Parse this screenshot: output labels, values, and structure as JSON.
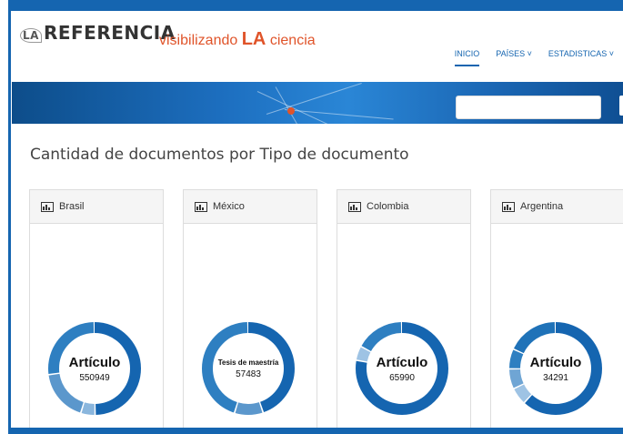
{
  "header": {
    "logo_prefix": "LA",
    "logo_text": "REFERENCIA",
    "tagline_pre": "visibilizando ",
    "tagline_bold": "LA",
    "tagline_post": " ciencia"
  },
  "nav": {
    "items": [
      {
        "label": "INICIO"
      },
      {
        "label": "PAÍSES ˅"
      },
      {
        "label": "ESTADISTICAS ˅"
      }
    ]
  },
  "search": {
    "placeholder": ""
  },
  "page": {
    "title": "Cantidad de documentos por Tipo de documento"
  },
  "colors": {
    "primary": "#1565b0",
    "accent": "#e0542a",
    "ring_light": "#6fa5d4",
    "ring_mid": "#2e7fc1"
  },
  "panels": [
    {
      "country": "Brasil",
      "center_label": "Artículo",
      "center_value": "550949",
      "small": false
    },
    {
      "country": "México",
      "center_label": "Tesis de maestría",
      "center_value": "57483",
      "small": true
    },
    {
      "country": "Colombia",
      "center_label": "Artículo",
      "center_value": "65990",
      "small": false
    },
    {
      "country": "Argentina",
      "center_label": "Artículo",
      "center_value": "34291",
      "small": false
    }
  ]
}
